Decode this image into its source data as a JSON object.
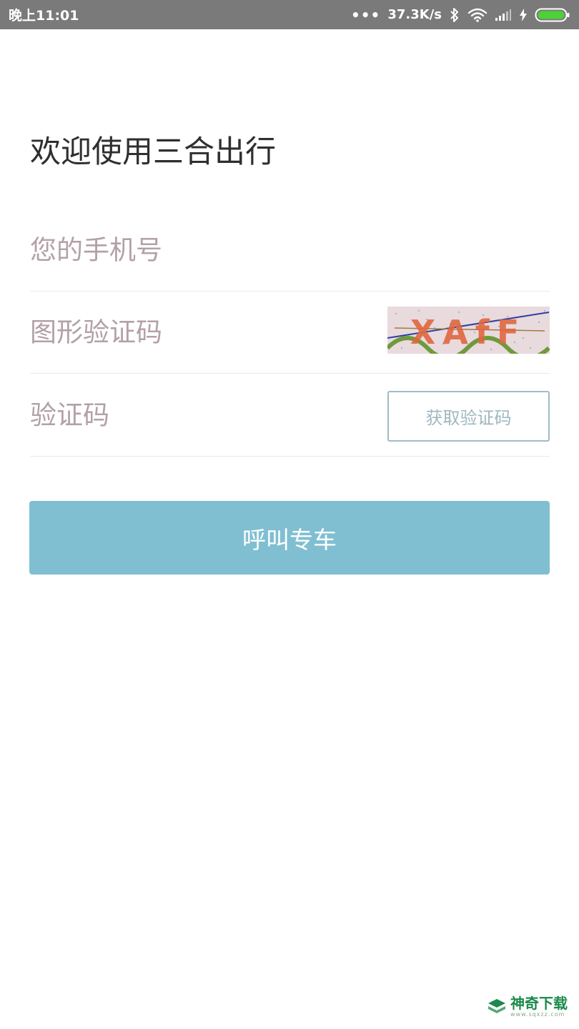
{
  "status_bar": {
    "time": "晚上11:01",
    "network_speed": "37.3K/s",
    "icons": [
      "more-dots-icon",
      "bluetooth-icon",
      "wifi-icon",
      "signal-icon",
      "charging-icon",
      "battery-icon"
    ],
    "battery_color": "#4cd137"
  },
  "page": {
    "title": "欢迎使用三合出行"
  },
  "form": {
    "phone_placeholder": "您的手机号",
    "captcha_placeholder": "图形验证码",
    "captcha_image_text": "XAfF",
    "sms_code_placeholder": "验证码",
    "get_code_label": "获取验证码",
    "submit_label": "呼叫专车"
  },
  "watermark": {
    "name": "神奇下载",
    "url": "www.sqxzz.com"
  },
  "colors": {
    "status_bar_bg": "#7a7a7a",
    "primary_button": "#80bfd2",
    "placeholder_text": "#b3a1a6",
    "outline_button_border": "#9fbcc6",
    "divider": "#f0e6e9"
  }
}
